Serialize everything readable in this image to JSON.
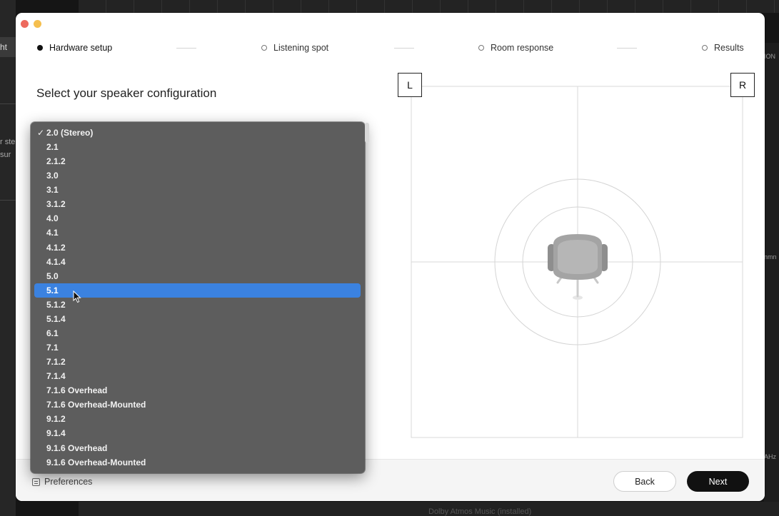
{
  "background": {
    "left_tab_label": "ht",
    "left_text_lines": [
      "r ste",
      "sur"
    ],
    "right_labels": [
      "ION",
      "nmn",
      "AHz"
    ],
    "bottom_text": "Dolby Atmos Music (installed)"
  },
  "stepper": {
    "steps": [
      {
        "label": "Hardware setup",
        "active": true
      },
      {
        "label": "Listening spot",
        "active": false
      },
      {
        "label": "Room response",
        "active": false
      },
      {
        "label": "Results",
        "active": false
      }
    ]
  },
  "page_title": "Select your speaker configuration",
  "speakers": {
    "left_label": "L",
    "right_label": "R"
  },
  "dropdown": {
    "selected_index": 0,
    "highlighted_index": 11,
    "options": [
      "2.0 (Stereo)",
      "2.1",
      "2.1.2",
      "3.0",
      "3.1",
      "3.1.2",
      "4.0",
      "4.1",
      "4.1.2",
      "4.1.4",
      "5.0",
      "5.1",
      "5.1.2",
      "5.1.4",
      "6.1",
      "7.1",
      "7.1.2",
      "7.1.4",
      "7.1.6 Overhead",
      "7.1.6 Overhead-Mounted",
      "9.1.2",
      "9.1.4",
      "9.1.6 Overhead",
      "9.1.6 Overhead-Mounted"
    ]
  },
  "footer": {
    "preferences_label": "Preferences",
    "back_label": "Back",
    "next_label": "Next"
  },
  "colors": {
    "highlight": "#3b82e0",
    "menu_bg": "#5d5d5d",
    "primary_button": "#111111"
  }
}
